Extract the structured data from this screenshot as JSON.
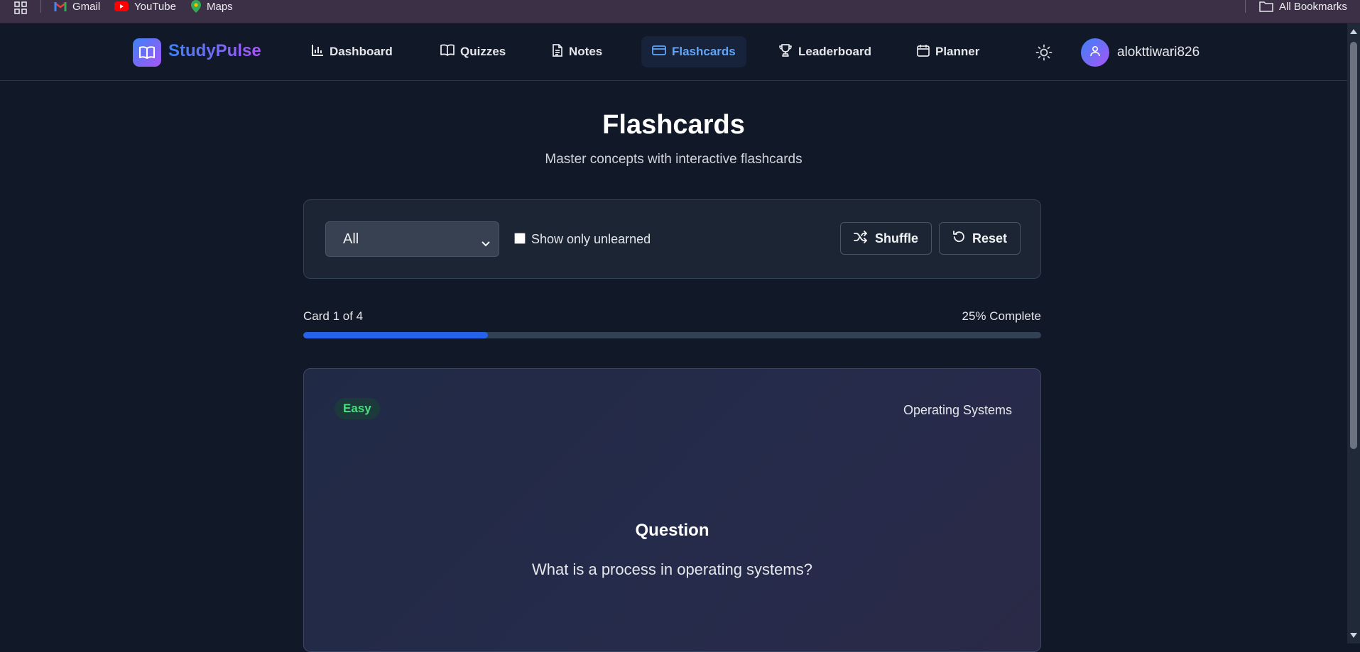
{
  "bookmarks": {
    "apps_icon": "apps-grid-icon",
    "items": [
      {
        "label": "Gmail",
        "icon": "gmail-icon"
      },
      {
        "label": "YouTube",
        "icon": "youtube-icon"
      },
      {
        "label": "Maps",
        "icon": "maps-icon"
      }
    ],
    "all_bookmarks": {
      "label": "All Bookmarks",
      "icon": "folder-icon"
    }
  },
  "header": {
    "brand": "StudyPulse",
    "brand_icon": "open-book-icon",
    "nav": [
      {
        "label": "Dashboard",
        "icon": "bar-chart-icon",
        "active": false
      },
      {
        "label": "Quizzes",
        "icon": "book-icon",
        "active": false
      },
      {
        "label": "Notes",
        "icon": "document-icon",
        "active": false
      },
      {
        "label": "Flashcards",
        "icon": "card-icon",
        "active": true
      },
      {
        "label": "Leaderboard",
        "icon": "trophy-icon",
        "active": false
      },
      {
        "label": "Planner",
        "icon": "calendar-icon",
        "active": false
      }
    ],
    "theme_icon": "sun-icon",
    "username": "alokttiwari826"
  },
  "page": {
    "title": "Flashcards",
    "subtitle": "Master concepts with interactive flashcards"
  },
  "controls": {
    "category_selected": "All",
    "unlearned_label": "Show only unlearned",
    "unlearned_checked": false,
    "shuffle_label": "Shuffle",
    "reset_label": "Reset"
  },
  "progress": {
    "card_text": "Card 1 of 4",
    "complete_text": "25% Complete",
    "fraction": 0.25
  },
  "card": {
    "difficulty": "Easy",
    "topic": "Operating Systems",
    "heading": "Question",
    "question": "What is a process in operating systems?"
  },
  "colors": {
    "background": "#111827",
    "accent": "#2563eb",
    "active_nav": "#60a5fa",
    "easy_badge": "#4ade80"
  }
}
